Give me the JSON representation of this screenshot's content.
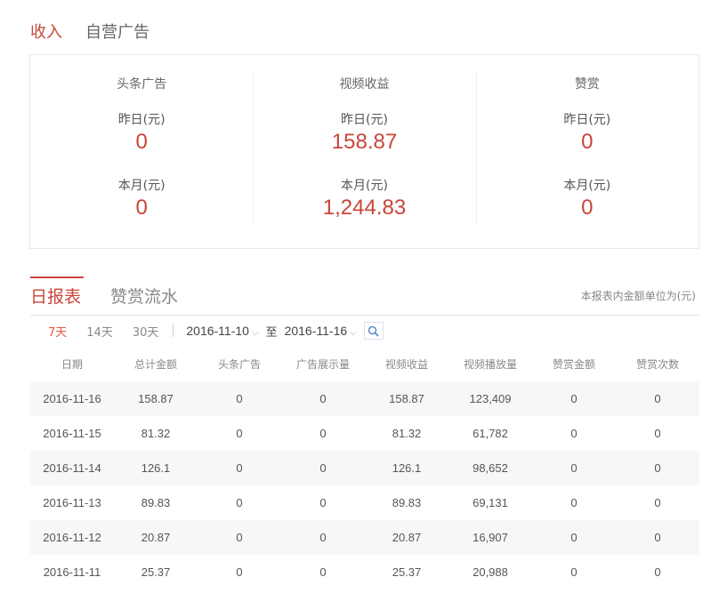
{
  "top_tabs": [
    {
      "label": "收入",
      "active": true
    },
    {
      "label": "自营广告",
      "active": false
    }
  ],
  "summary": [
    {
      "title": "头条广告",
      "yesterday_label": "昨日(元)",
      "yesterday_value": "0",
      "month_label": "本月(元)",
      "month_value": "0"
    },
    {
      "title": "视频收益",
      "yesterday_label": "昨日(元)",
      "yesterday_value": "158.87",
      "month_label": "本月(元)",
      "month_value": "1,244.83"
    },
    {
      "title": "赞赏",
      "yesterday_label": "昨日(元)",
      "yesterday_value": "0",
      "month_label": "本月(元)",
      "month_value": "0"
    }
  ],
  "report_tabs": [
    {
      "label": "日报表",
      "active": true
    },
    {
      "label": "赞赏流水",
      "active": false
    }
  ],
  "unit_note": "本报表内金额单位为(元)",
  "filter": {
    "ranges": [
      {
        "label": "7天",
        "active": true
      },
      {
        "label": "14天",
        "active": false
      },
      {
        "label": "30天",
        "active": false
      }
    ],
    "start_date": "2016-11-10",
    "to_label": "至",
    "end_date": "2016-11-16",
    "search_icon": "search-icon"
  },
  "table": {
    "columns": [
      "日期",
      "总计金额",
      "头条广告",
      "广告展示量",
      "视频收益",
      "视频播放量",
      "赞赏金额",
      "赞赏次数"
    ],
    "rows": [
      [
        "2016-11-16",
        "158.87",
        "0",
        "0",
        "158.87",
        "123,409",
        "0",
        "0"
      ],
      [
        "2016-11-15",
        "81.32",
        "0",
        "0",
        "81.32",
        "61,782",
        "0",
        "0"
      ],
      [
        "2016-11-14",
        "126.1",
        "0",
        "0",
        "126.1",
        "98,652",
        "0",
        "0"
      ],
      [
        "2016-11-13",
        "89.83",
        "0",
        "0",
        "89.83",
        "69,131",
        "0",
        "0"
      ],
      [
        "2016-11-12",
        "20.87",
        "0",
        "0",
        "20.87",
        "16,907",
        "0",
        "0"
      ],
      [
        "2016-11-11",
        "25.37",
        "0",
        "0",
        "25.37",
        "20,988",
        "0",
        "0"
      ]
    ]
  },
  "colors": {
    "accent": "#c9453a",
    "range_active": "#e25c3c",
    "search_icon": "#5b8fc7"
  }
}
